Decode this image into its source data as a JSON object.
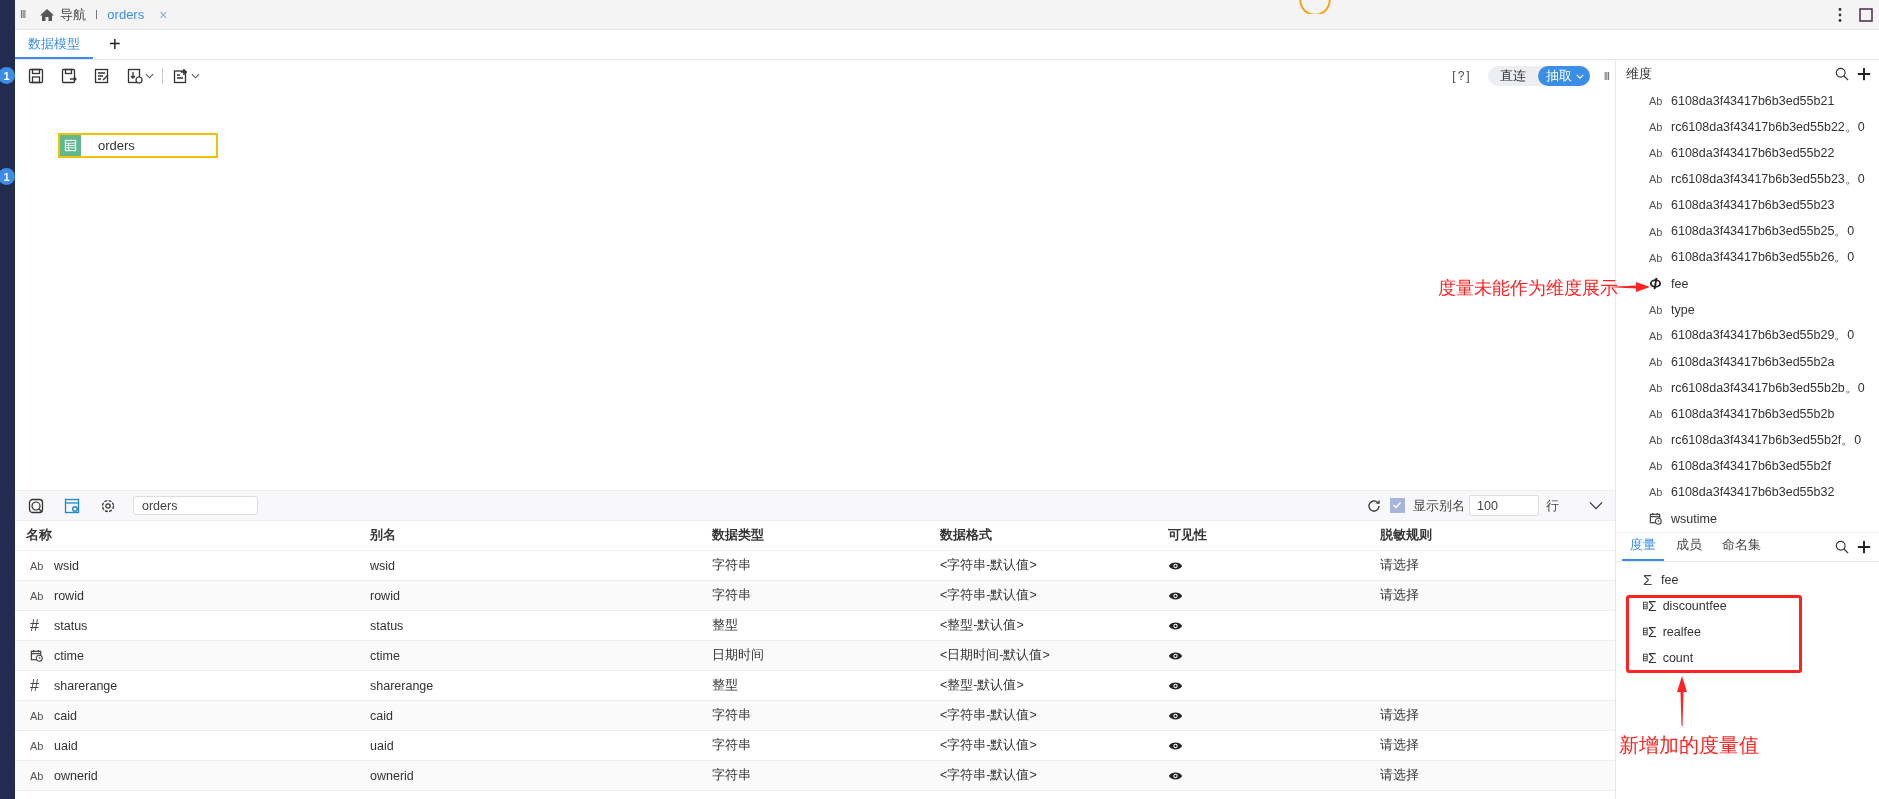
{
  "sidebar": {
    "badges": [
      "1",
      "1"
    ]
  },
  "nav": {
    "handle": "III",
    "home": {
      "label": "导航"
    },
    "tabs": [
      {
        "label": "orders",
        "selected": true,
        "close": "×"
      }
    ]
  },
  "editor_tabs": {
    "tabs": [
      {
        "label": "数据模型",
        "selected": true
      }
    ],
    "add": "+"
  },
  "toolbar": {
    "help": "[?]",
    "mode": [
      {
        "label": "直连",
        "selected": false
      },
      {
        "label": "抽取",
        "selected": true
      }
    ],
    "handle": "III"
  },
  "canvas": {
    "nodes": [
      {
        "label": "orders"
      }
    ]
  },
  "table_panel": {
    "search": {
      "value": "orders"
    },
    "show_alias": {
      "label": "显示别名",
      "checked": true
    },
    "rows_count": {
      "value": "100"
    },
    "rows_unit": "行",
    "columns": [
      "名称",
      "别名",
      "数据类型",
      "数据格式",
      "可见性",
      "脱敏规则"
    ],
    "rows": [
      {
        "kind": "string",
        "icon": "Ab",
        "name": "wsid",
        "alias": "wsid",
        "data_type": "字符串",
        "format": "<字符串-默认值>",
        "visible": true,
        "masking": "请选择"
      },
      {
        "kind": "string",
        "icon": "Ab",
        "name": "rowid",
        "alias": "rowid",
        "data_type": "字符串",
        "format": "<字符串-默认值>",
        "visible": true,
        "masking": "请选择"
      },
      {
        "kind": "number",
        "icon": "#",
        "name": "status",
        "alias": "status",
        "data_type": "整型",
        "format": "<整型-默认值>",
        "visible": true
      },
      {
        "kind": "date",
        "name": "ctime",
        "alias": "ctime",
        "data_type": "日期时间",
        "format": "<日期时间-默认值>",
        "visible": true
      },
      {
        "kind": "number",
        "icon": "#",
        "name": "sharerange",
        "alias": "sharerange",
        "data_type": "整型",
        "format": "<整型-默认值>",
        "visible": true
      },
      {
        "kind": "string",
        "icon": "Ab",
        "name": "caid",
        "alias": "caid",
        "data_type": "字符串",
        "format": "<字符串-默认值>",
        "visible": true,
        "masking": "请选择"
      },
      {
        "kind": "string",
        "icon": "Ab",
        "name": "uaid",
        "alias": "uaid",
        "data_type": "字符串",
        "format": "<字符串-默认值>",
        "visible": true,
        "masking": "请选择"
      },
      {
        "kind": "string",
        "icon": "Ab",
        "name": "ownerid",
        "alias": "ownerid",
        "data_type": "字符串",
        "format": "<字符串-默认值>",
        "visible": true,
        "masking": "请选择"
      }
    ]
  },
  "dimensions": {
    "title": "维度",
    "items": [
      {
        "kind": "string",
        "icon": "Ab",
        "label": "6108da3f43417b6b3ed55b21"
      },
      {
        "kind": "string",
        "icon": "Ab",
        "label": "rc6108da3f43417b6b3ed55b22。0"
      },
      {
        "kind": "string",
        "icon": "Ab",
        "label": "6108da3f43417b6b3ed55b22"
      },
      {
        "kind": "string",
        "icon": "Ab",
        "label": "rc6108da3f43417b6b3ed55b23。0"
      },
      {
        "kind": "string",
        "icon": "Ab",
        "label": "6108da3f43417b6b3ed55b23"
      },
      {
        "kind": "string",
        "icon": "Ab",
        "label": "6108da3f43417b6b3ed55b25。0"
      },
      {
        "kind": "string",
        "icon": "Ab",
        "label": "6108da3f43417b6b3ed55b26。0"
      },
      {
        "kind": "measure",
        "label": "fee"
      },
      {
        "kind": "string",
        "icon": "Ab",
        "label": "type"
      },
      {
        "kind": "string",
        "icon": "Ab",
        "label": "6108da3f43417b6b3ed55b29。0"
      },
      {
        "kind": "string",
        "icon": "Ab",
        "label": "6108da3f43417b6b3ed55b2a"
      },
      {
        "kind": "string",
        "icon": "Ab",
        "label": "rc6108da3f43417b6b3ed55b2b。0"
      },
      {
        "kind": "string",
        "icon": "Ab",
        "label": "6108da3f43417b6b3ed55b2b"
      },
      {
        "kind": "string",
        "icon": "Ab",
        "label": "rc6108da3f43417b6b3ed55b2f。0"
      },
      {
        "kind": "string",
        "icon": "Ab",
        "label": "6108da3f43417b6b3ed55b2f"
      },
      {
        "kind": "string",
        "icon": "Ab",
        "label": "6108da3f43417b6b3ed55b32"
      },
      {
        "kind": "date",
        "label": "wsutime"
      }
    ]
  },
  "measures": {
    "tabs": [
      {
        "label": "度量",
        "selected": true
      },
      {
        "label": "成员",
        "selected": false
      },
      {
        "label": "命名集",
        "selected": false
      }
    ],
    "items": [
      {
        "kind": "sum",
        "icon": "Σ",
        "label": "fee"
      },
      {
        "kind": "calc",
        "icon": "Σ",
        "label": "discountfee"
      },
      {
        "kind": "calc",
        "icon": "Σ",
        "label": "realfee"
      },
      {
        "kind": "calc",
        "icon": "Σ",
        "label": "count"
      }
    ]
  },
  "annotations": [
    {
      "text": "度量未能作为维度展示"
    },
    {
      "text": "新增加的度量值"
    }
  ]
}
